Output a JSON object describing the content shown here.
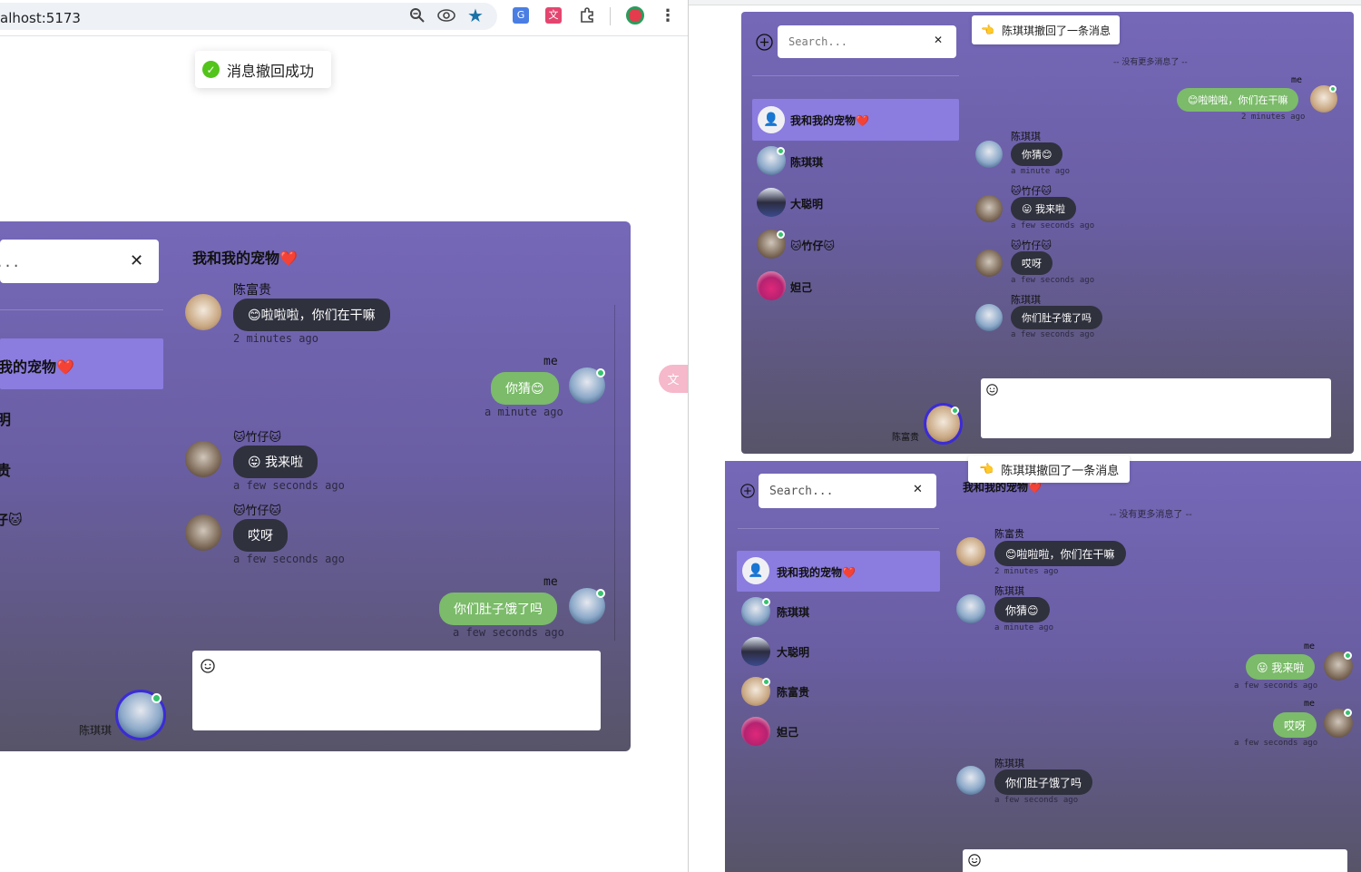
{
  "browser": {
    "url": "alhost:5173",
    "toast": "消息撤回成功"
  },
  "main": {
    "search_placeholder": "Search...",
    "title": "我和我的宠物❤️",
    "sidebar_items": [
      "我的宠物❤️",
      "明",
      "贵",
      "仔🐱"
    ],
    "current_user": "陈琪琪",
    "messages": [
      {
        "sender": "陈富贵",
        "text": "😊啦啦啦，你们在干嘛",
        "time": "2 minutes ago",
        "me": false
      },
      {
        "sender": "me",
        "text": "你猜😊",
        "time": "a minute ago",
        "me": true
      },
      {
        "sender": "🐱竹仔🐱",
        "text": "😛 我来啦",
        "time": "a few seconds ago",
        "me": false
      },
      {
        "sender": "🐱竹仔🐱",
        "text": "哎呀",
        "time": "a few seconds ago",
        "me": false
      },
      {
        "sender": "me",
        "text": "你们肚子饿了吗",
        "time": "a few seconds ago",
        "me": true
      }
    ],
    "input_icon": "emoji-smile-icon"
  },
  "win1": {
    "search_placeholder": "Search...",
    "notice": "陈琪琪撤回了一条消息",
    "no_more": "-- 没有更多消息了 --",
    "contacts": [
      "我和我的宠物❤️",
      "陈琪琪",
      "大聪明",
      "🐱竹仔🐱",
      "妲己"
    ],
    "current_user": "陈富贵",
    "messages": [
      {
        "sender": "me",
        "text": "😊啦啦啦，你们在干嘛",
        "time": "2 minutes ago",
        "me": true
      },
      {
        "sender": "陈琪琪",
        "text": "你猜😊",
        "time": "a minute ago",
        "me": false
      },
      {
        "sender": "🐱竹仔🐱",
        "text": "😛 我来啦",
        "time": "a few seconds ago",
        "me": false
      },
      {
        "sender": "🐱竹仔🐱",
        "text": "哎呀",
        "time": "a few seconds ago",
        "me": false
      },
      {
        "sender": "陈琪琪",
        "text": "你们肚子饿了吗",
        "time": "a few seconds ago",
        "me": false
      }
    ]
  },
  "win2": {
    "search_placeholder": "Search...",
    "notice": "陈琪琪撤回了一条消息",
    "title": "我和我的宠物❤️",
    "no_more": "-- 没有更多消息了 --",
    "contacts": [
      "我和我的宠物❤️",
      "陈琪琪",
      "大聪明",
      "陈富贵",
      "妲己"
    ],
    "messages": [
      {
        "sender": "陈富贵",
        "text": "😊啦啦啦，你们在干嘛",
        "time": "2 minutes ago",
        "me": false
      },
      {
        "sender": "陈琪琪",
        "text": "你猜😊",
        "time": "a minute ago",
        "me": false
      },
      {
        "sender": "me",
        "text": "😛 我来啦",
        "time": "a few seconds ago",
        "me": true
      },
      {
        "sender": "me",
        "text": "哎呀",
        "time": "a few seconds ago",
        "me": true
      },
      {
        "sender": "陈琪琪",
        "text": "你们肚子饿了吗",
        "time": "a few seconds ago",
        "me": false
      }
    ]
  },
  "colors": {
    "accent": "#8b7ce0",
    "me_bubble": "#7bbb6a",
    "other_bubble": "#2f313d",
    "online": "#37c26e"
  }
}
